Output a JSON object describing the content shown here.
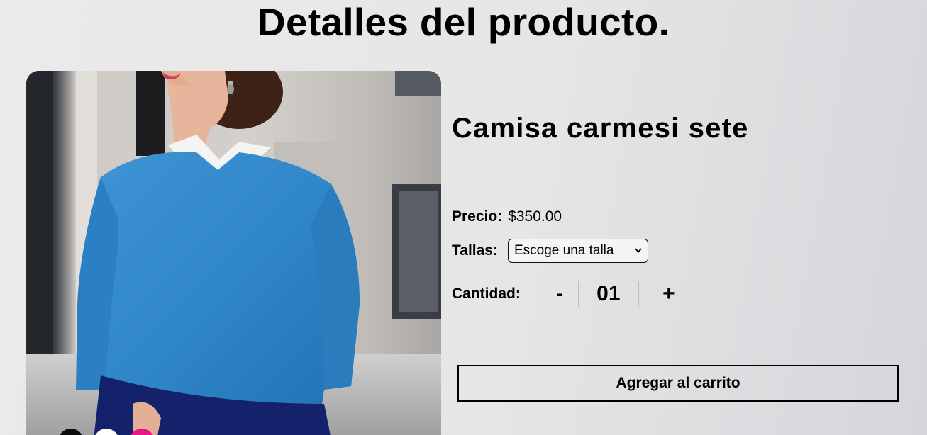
{
  "page": {
    "title": "Detalles del producto."
  },
  "product": {
    "name": "Camisa carmesi sete",
    "price_label": "Precio:",
    "price_value": "$350.00",
    "sizes_label": "Tallas:",
    "size_select": {
      "selected": "Escoge una talla"
    },
    "quantity_label": "Cantidad:",
    "quantity": {
      "minus": "-",
      "value": "01",
      "plus": "+"
    },
    "add_to_cart_label": "Agregar al carrito",
    "color_options": [
      {
        "name": "black",
        "color": "#0c0c0c"
      },
      {
        "name": "white",
        "color": "#ffffff"
      },
      {
        "name": "pink",
        "color": "#e8178a"
      }
    ]
  },
  "icons": {
    "select_arrow": "chevron-down-icon"
  }
}
